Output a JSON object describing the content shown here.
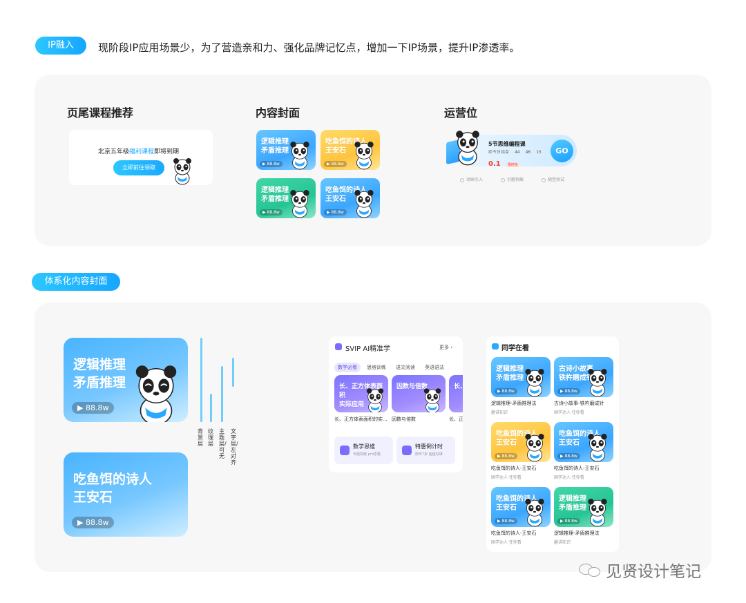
{
  "top": {
    "pill_label": "IP融入",
    "description": "现阶段IP应用场景少，为了营造亲和力、强化品牌记忆点，增加一下IP场景，提升IP渗透率。"
  },
  "sections": {
    "footer": {
      "title": "页尾课程推荐",
      "notice_prefix": "北京五年级",
      "notice_highlight": "福利课程",
      "notice_suffix": "即将到期",
      "button": "立即前往领取"
    },
    "cover": {
      "title": "内容封面",
      "cards": [
        {
          "text": "逻辑推理\n矛盾推理",
          "views": "▶ 88.8w",
          "theme": "blue"
        },
        {
          "text": "吃鱼饵的诗人\n王安石",
          "views": "▶ 88.8w",
          "theme": "yellow"
        },
        {
          "text": "逻辑推理\n矛盾推理",
          "views": "▶ 88.8w",
          "theme": "green"
        },
        {
          "text": "吃鱼饵的诗人\n王安石",
          "views": "▶ 88.8w",
          "theme": "blue"
        }
      ]
    },
    "ops": {
      "title": "运营位",
      "course": "5节思维编程课",
      "sub_prefix": "距今日结束",
      "countdown": [
        "44",
        "46",
        "15"
      ],
      "price": "0.1",
      "price_tag": "限时抢",
      "go": "GO",
      "features": [
        "动画引入",
        "引题拆解",
        "随堂测试"
      ]
    }
  },
  "system": {
    "pill_label": "体系化内容封面",
    "big_cards": [
      {
        "text": "逻辑推理\n矛盾推理",
        "views": "▶ 88.8w"
      },
      {
        "text": "吃鱼饵的诗人\n王安石",
        "views": "▶ 88.8w"
      }
    ],
    "layers": [
      "背景层",
      "纹理层",
      "主题层/可无",
      "文字层/左对齐"
    ],
    "svip": {
      "title": "SVIP AI精准学",
      "more": "更多 ›",
      "tabs": [
        "数学必看",
        "思维训练",
        "语文阅读",
        "英语语法"
      ],
      "cards": [
        {
          "text": "长、正方体表面积\n实际应用",
          "caption": "长、正方体表面积的实..."
        },
        {
          "text": "因数与倍数",
          "caption": "因数与倍数"
        },
        {
          "text": "长、",
          "caption": "长、正方"
        }
      ],
      "entries": [
        {
          "title": "数学思维",
          "sub": "专题突破 prd思路"
        },
        {
          "title": "特惠倒计时",
          "sub": "限专7折 超值好课"
        }
      ]
    },
    "classmates": {
      "title": "同学在看",
      "items": [
        {
          "text": "逻辑推理\n矛盾推理",
          "views": "▶ 88.8w",
          "theme": "blue",
          "caption": "逻辑推理-矛盾推理法",
          "sub": "趣讲知识"
        },
        {
          "text": "古诗小故事\n铁杵磨成针",
          "views": "▶ 88.8w",
          "theme": "blue",
          "caption": "古诗小故事-铁杵磨成针",
          "sub": "国学达人·任你看"
        },
        {
          "text": "吃鱼饵的诗人\n王安石",
          "views": "▶ 88.8w",
          "theme": "yellow",
          "caption": "吃鱼饵的诗人-王安石",
          "sub": "国学达人·任你看"
        },
        {
          "text": "吃鱼饵的诗人\n王安石",
          "views": "▶ 88.8w",
          "theme": "blue",
          "caption": "吃鱼饵的诗人-王安石",
          "sub": "国学达人·任你看"
        },
        {
          "text": "吃鱼饵的诗人\n王安石",
          "views": "▶ 88.8w",
          "theme": "blue",
          "caption": "吃鱼饵的诗人-王安石",
          "sub": "国学达人·任你看"
        },
        {
          "text": "逻辑推理\n矛盾推理",
          "views": "▶ 88.8w",
          "theme": "green",
          "caption": "逻辑推理-矛盾推理法",
          "sub": "趣讲知识"
        }
      ]
    }
  },
  "watermark": "见贤设计笔记",
  "colors": {
    "accent": "#1aa9ff",
    "panel": "#f7f7f8",
    "price_red": "#ff3b30"
  }
}
